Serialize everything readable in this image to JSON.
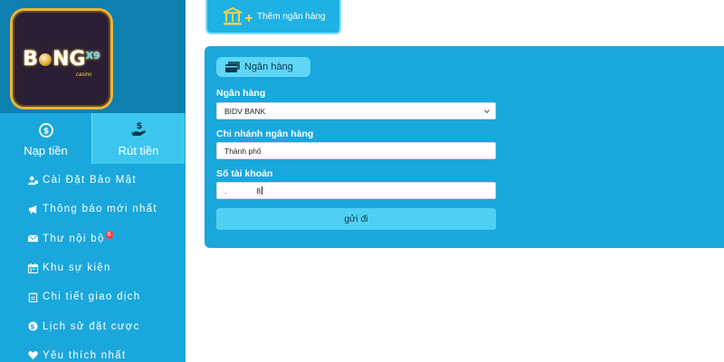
{
  "brand": {
    "logo_text_left": "B",
    "logo_text_right": "NG",
    "logo_suffix": "X9",
    "logo_sub": "casino"
  },
  "money_tabs": {
    "deposit": "Nạp tiền",
    "withdraw": "Rút tiền"
  },
  "menu": [
    {
      "label": "Cài Đặt Bảo Mật",
      "icon": "user-lock-icon"
    },
    {
      "label": "Thông báo mới nhất",
      "icon": "megaphone-icon"
    },
    {
      "label": "Thư nội bộ",
      "icon": "envelope-icon",
      "badge": "6"
    },
    {
      "label": "Khu sự kiện",
      "icon": "calendar-icon"
    },
    {
      "label": "Chi tiết giao dịch",
      "icon": "clipboard-icon"
    },
    {
      "label": "Lịch sử đặt cược",
      "icon": "dollar-circle-icon"
    },
    {
      "label": "Yêu thích nhất",
      "icon": "heart-icon"
    }
  ],
  "add_bank_label": "Thêm ngân hàng",
  "panel": {
    "tag_label": "Ngân hàng",
    "bank_label": "Ngân hàng",
    "bank_value": "BIDV BANK",
    "branch_label": "Chi nhánh ngân hàng",
    "branch_value": "Thành phố",
    "account_label": "Số tài khoản",
    "account_value": ".              8",
    "submit_label": "gửi đi"
  },
  "colors": {
    "sidebar": "#1aa7dc",
    "logo_bg": "#0f7fb0",
    "panel": "#1aa7dc",
    "accent": "#4fd0f2",
    "badge": "#ff3b3b"
  }
}
